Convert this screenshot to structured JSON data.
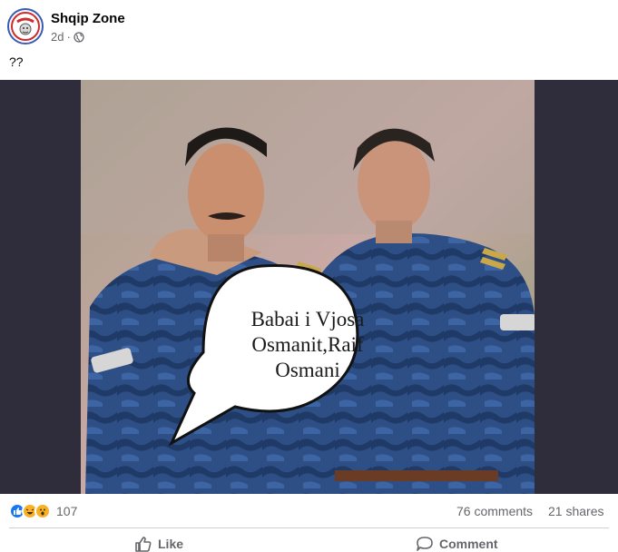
{
  "post": {
    "page_name": "Shqip Zone",
    "time": "2d",
    "separator": "·",
    "audience_icon": "globe-icon",
    "caption": "??"
  },
  "avatar": {
    "logo_text": "SHQIP ZONE"
  },
  "image": {
    "speech_bubble_lines": [
      "Babai i Vjosa",
      "Osmanit,Raif",
      "Osmani"
    ]
  },
  "stats": {
    "reaction_icons": [
      "like-icon",
      "haha-icon",
      "wow-icon"
    ],
    "reaction_count": "107",
    "comments": "76 comments",
    "shares": "21 shares"
  },
  "actions": {
    "like_label": "Like",
    "comment_label": "Comment"
  },
  "colors": {
    "brand_blue": "#1877f2",
    "media_backdrop": "#2f2d3c",
    "secondary_text": "#65676b"
  }
}
